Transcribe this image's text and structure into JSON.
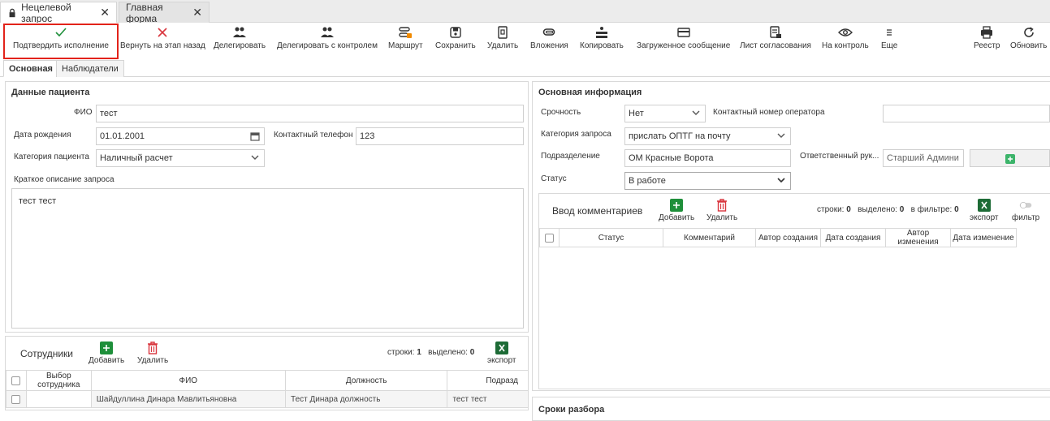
{
  "window_tabs": [
    {
      "label": "Нецелевой запрос"
    },
    {
      "label": "Главная форма"
    }
  ],
  "toolbar": {
    "confirm": "Подтвердить исполнение",
    "return": "Вернуть на этап назад",
    "delegate": "Делегировать",
    "delegate_control": "Делегировать с контролем",
    "route": "Маршрут",
    "save": "Сохранить",
    "delete": "Удалить",
    "attachments": "Вложения",
    "copy": "Копировать",
    "loaded_message": "Загруженное сообщение",
    "approval_sheet": "Лист согласования",
    "on_control": "На контроль",
    "more": "Еще",
    "registry": "Реестр",
    "refresh": "Обновить"
  },
  "inner_tabs": [
    "Основная",
    "Наблюдатели"
  ],
  "patient": {
    "title": "Данные пациента",
    "fio_label": "ФИО",
    "fio_value": "тест",
    "dob_label": "Дата рождения",
    "dob_value": "01.01.2001",
    "phone_label": "Контактный телефон",
    "phone_value": "123",
    "category_label": "Категория пациента",
    "category_value": "Наличный расчет",
    "desc_label": "Краткое описание запроса",
    "desc_value": "тест тест"
  },
  "employees": {
    "title": "Сотрудники",
    "add": "Добавить",
    "delete": "Удалить",
    "rows_label": "строки:",
    "rows_value": "1",
    "selected_label": "выделено:",
    "selected_value": "0",
    "export": "экспорт",
    "columns": [
      "Выбор сотрудника",
      "ФИО",
      "Должность",
      "Подразд"
    ],
    "rows": [
      {
        "fio": "Шайдуллина Динара Мавлитьяновна",
        "position": "Тест Динара должность",
        "dept": "тест тест"
      }
    ]
  },
  "main_info": {
    "title": "Основная информация",
    "urgency_label": "Срочность",
    "urgency_value": "Нет",
    "operator_phone_label": "Контактный номер оператора",
    "operator_phone_value": "",
    "req_category_label": "Категория запроса",
    "req_category_value": "прислать ОПТГ на почту",
    "dept_label": "Подразделение",
    "dept_value": "ОМ Красные Ворота",
    "responsible_label": "Ответственный рук...",
    "responsible_value": "Старший Админи",
    "status_label": "Статус",
    "status_value": "В работе"
  },
  "comments": {
    "title": "Ввод комментариев",
    "add": "Добавить",
    "delete": "Удалить",
    "rows_label": "строки:",
    "rows_value": "0",
    "selected_label": "выделено:",
    "selected_value": "0",
    "filter_label": "в фильтре:",
    "filter_value": "0",
    "export": "экспорт",
    "filter": "фильтр",
    "columns": [
      "Статус",
      "Комментарий",
      "Автор создания",
      "Дата создания",
      "Автор изменения",
      "Дата изменение"
    ]
  },
  "deadlines": {
    "title": "Сроки разбора"
  },
  "colors": {
    "accent_green": "#1e8f3a",
    "delete_red": "#d9363e",
    "highlight": "#e2231a"
  }
}
